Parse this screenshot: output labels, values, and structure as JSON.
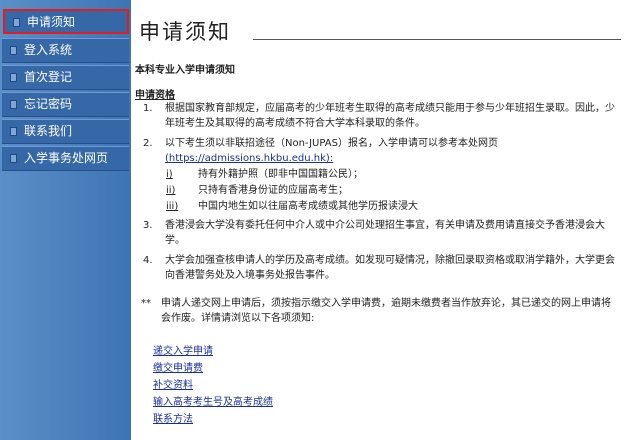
{
  "sidebar": {
    "items": [
      {
        "label": "申请须知",
        "active": true
      },
      {
        "label": "登入系统"
      },
      {
        "label": "首次登记"
      },
      {
        "label": "忘记密码"
      },
      {
        "label": "联系我们"
      },
      {
        "label": "入学事务处网页"
      }
    ]
  },
  "main": {
    "title": "申请须知",
    "subtitle": "本科专业入学申请须知",
    "requirements_heading": "申请资格",
    "items": [
      {
        "num": "1.",
        "text": "根据国家教育部规定，应届高考的少年班考生取得的高考成绩只能用于参与少年班招生录取。因此，少年班考生及其取得的高考成绩不符合大学本科录取的条件。"
      },
      {
        "num": "2.",
        "text": "以下考生须以非联招途径（Non-JUPAS）报名，入学申请可以参考本处网页",
        "link": "(https://admissions.hkbu.edu.hk):"
      },
      {
        "num": "3.",
        "text": "香港浸会大学没有委托任何中介人或中介公司处理招生事宜，有关申请及费用请直接交予香港浸会大学。"
      },
      {
        "num": "4.",
        "text": "大学会加强查核申请人的学历及高考成绩。如发现可疑情况，除撤回录取资格或取消学籍外，大学更会向香港警务处及入境事务处报告事件。"
      }
    ],
    "subitems": [
      {
        "num": "i)",
        "text": "持有外籍护照（即非中国国籍公民）；"
      },
      {
        "num": "ii)",
        "text": "只持有香港身份证的应届高考生；"
      },
      {
        "num": "iii)",
        "text": "中国内地生如以往届高考成绩或其他学历报读浸大"
      }
    ],
    "note_marker": "**",
    "note": "申请人递交网上申请后，须按指示缴交入学申请费，逾期未缴费者当作放弃论，其已递交的网上申请将会作废。详情请浏览以下各项须知:",
    "links": [
      "递交入学申请",
      "缴交申请费",
      "补交资料",
      "输入高考考生号及高考成绩",
      "联系方法"
    ]
  }
}
